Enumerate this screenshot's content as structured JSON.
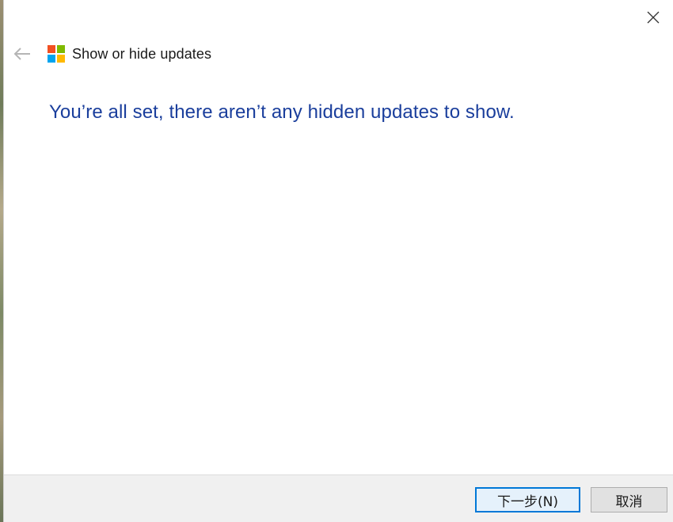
{
  "window": {
    "title": "Show or hide updates"
  },
  "main": {
    "heading": "You’re all set, there aren’t any hidden updates to show."
  },
  "footer": {
    "next_label": "下一步(N)",
    "cancel_label": "取消"
  },
  "icons": {
    "back": "back-arrow-icon",
    "close": "close-icon",
    "app": "windows-logo-icon"
  },
  "colors": {
    "heading": "#1a3e9c",
    "logo_red": "#f25022",
    "logo_green": "#7fba00",
    "logo_blue": "#00a4ef",
    "logo_yellow": "#ffb900",
    "default_button_border": "#0078d7"
  }
}
